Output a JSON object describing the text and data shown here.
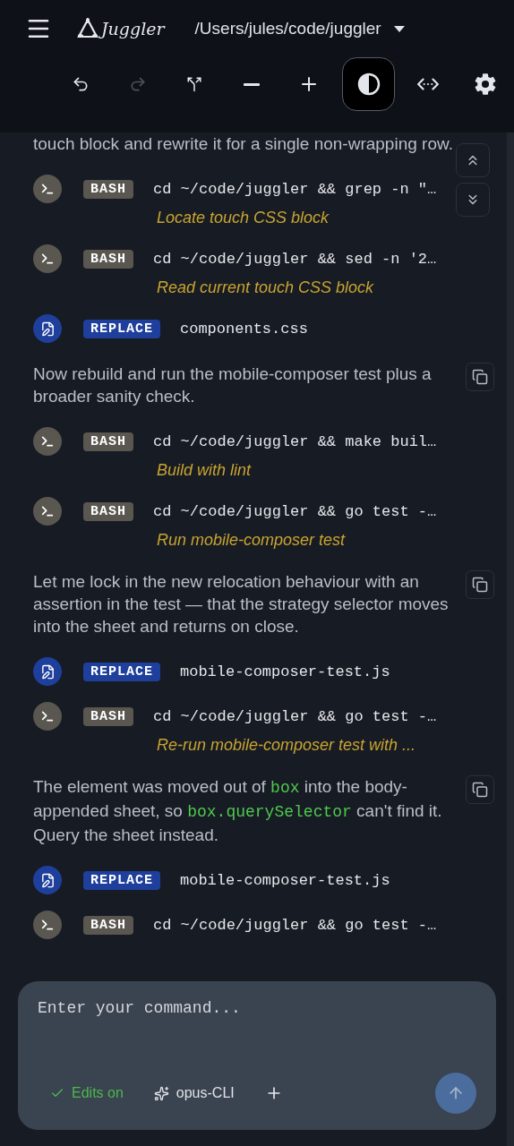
{
  "header": {
    "app_name": "Juggler",
    "path": "/Users/jules/code/juggler"
  },
  "toolbar": [
    {
      "kind": "undo",
      "disabled": false,
      "selected": false
    },
    {
      "kind": "redo",
      "disabled": true,
      "selected": false
    },
    {
      "kind": "fork",
      "disabled": false,
      "selected": false
    },
    {
      "kind": "zoom-out",
      "disabled": false,
      "selected": false
    },
    {
      "kind": "zoom-in",
      "disabled": false,
      "selected": false
    },
    {
      "kind": "contrast",
      "disabled": false,
      "selected": true
    },
    {
      "kind": "width",
      "disabled": false,
      "selected": false
    },
    {
      "kind": "settings",
      "disabled": false,
      "selected": false
    }
  ],
  "transcript": [
    {
      "kind": "message",
      "copy": false,
      "parts": [
        {
          "text": "touch block and rewrite it for a single non-wrapping row.",
          "code": false
        }
      ]
    },
    {
      "kind": "bash",
      "badge": "BASH",
      "command": "cd ~/code/juggler && grep -n \"…",
      "description": "Locate touch CSS block"
    },
    {
      "kind": "bash",
      "badge": "BASH",
      "command": "cd ~/code/juggler && sed -n '2…",
      "description": "Read current touch CSS block"
    },
    {
      "kind": "replace",
      "badge": "REPLACE",
      "file": "components.css"
    },
    {
      "kind": "message",
      "copy": true,
      "parts": [
        {
          "text": "Now rebuild and run the mobile-composer test plus a broader sanity check.",
          "code": false
        }
      ]
    },
    {
      "kind": "bash",
      "badge": "BASH",
      "command": "cd ~/code/juggler && make buil…",
      "description": "Build with lint"
    },
    {
      "kind": "bash",
      "badge": "BASH",
      "command": "cd ~/code/juggler && go test -…",
      "description": "Run mobile-composer test"
    },
    {
      "kind": "message",
      "copy": true,
      "parts": [
        {
          "text": "Let me lock in the new relocation behaviour with an assertion in the test — that the strategy selector moves into the sheet and returns on close.",
          "code": false
        }
      ]
    },
    {
      "kind": "replace",
      "badge": "REPLACE",
      "file": "mobile-composer-test.js"
    },
    {
      "kind": "bash",
      "badge": "BASH",
      "command": "cd ~/code/juggler && go test -…",
      "description": "Re-run mobile-composer test with ..."
    },
    {
      "kind": "message",
      "copy": true,
      "parts": [
        {
          "text": "The element was moved out of ",
          "code": false
        },
        {
          "text": "box",
          "code": true
        },
        {
          "text": " into the body-appended sheet, so ",
          "code": false
        },
        {
          "text": "box.querySelector",
          "code": true
        },
        {
          "text": " can't find it. Query the sheet instead.",
          "code": false
        }
      ]
    },
    {
      "kind": "replace",
      "badge": "REPLACE",
      "file": "mobile-composer-test.js"
    },
    {
      "kind": "bash",
      "badge": "BASH",
      "command": "cd ~/code/juggler && go test -…"
    }
  ],
  "composer": {
    "placeholder": "Enter your command...",
    "edits": {
      "label": "Edits on",
      "on": true
    },
    "model": "opus-CLI"
  }
}
